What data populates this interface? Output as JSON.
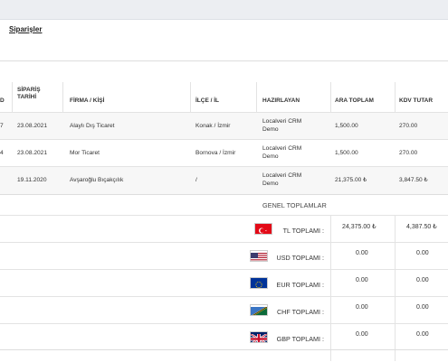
{
  "breadcrumb": "Siparişler",
  "table": {
    "headers": [
      {
        "key": "no",
        "label": "D"
      },
      {
        "key": "date",
        "label": "SİPARİŞ\nTARİHİ"
      },
      {
        "key": "firm",
        "label": "FİRMA / KİŞİ"
      },
      {
        "key": "loc",
        "label": "İLÇE / İL"
      },
      {
        "key": "prep",
        "label": "HAZIRLAYAN"
      },
      {
        "key": "sub",
        "label": "ARA TOPLAM"
      },
      {
        "key": "kdv",
        "label": "KDV TUTAR"
      }
    ],
    "rows": [
      {
        "no": "7",
        "date": "23.08.2021",
        "firm": "Alaylı Dış Ticaret",
        "loc": "Konak / İzmir",
        "prep": "Localveri CRM\nDemo",
        "sub": "1,500.00",
        "kdv": "270.00"
      },
      {
        "no": "4",
        "date": "23.08.2021",
        "firm": "Mor Ticaret",
        "loc": "Bornova / İzmir",
        "prep": "Localveri CRM\nDemo",
        "sub": "1,500.00",
        "kdv": "270.00"
      },
      {
        "no": "",
        "date": "19.11.2020",
        "firm": "Avşaroğlu Bıçakçılık",
        "loc": "/",
        "prep": "Localveri CRM\nDemo",
        "sub": "21,375.00 ₺",
        "kdv": "3,847.50 ₺"
      }
    ]
  },
  "totals": {
    "title": "GENEL TOPLAMLAR",
    "rows": [
      {
        "label": "TL TOPLAMI :",
        "flag": "tr-flag-icon",
        "sub": "24,375.00 ₺",
        "kdv": "4,387.50 ₺"
      },
      {
        "label": "USD TOPLAMI :",
        "flag": "us-flag-icon",
        "sub": "0.00",
        "kdv": "0.00"
      },
      {
        "label": "EUR TOPLAMI :",
        "flag": "eu-flag-icon",
        "sub": "0.00",
        "kdv": "0.00"
      },
      {
        "label": "CHF TOPLAMI :",
        "flag": "chf-flag-icon",
        "sub": "0.00",
        "kdv": "0.00"
      },
      {
        "label": "GBP TOPLAMI :",
        "flag": "gb-flag-icon",
        "sub": "0.00",
        "kdv": "0.00"
      }
    ]
  }
}
